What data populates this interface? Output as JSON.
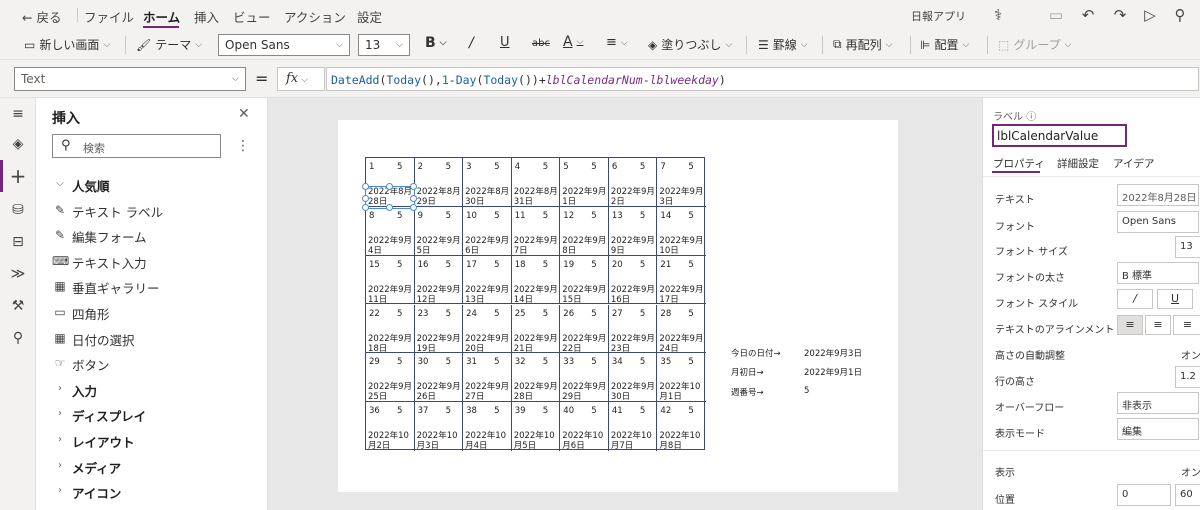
{
  "menu": {
    "back": "戻る",
    "items": [
      "ファイル",
      "ホーム",
      "挿入",
      "ビュー",
      "アクション",
      "設定"
    ],
    "app_name": "日報アプリ"
  },
  "toolbar": {
    "new_screen": "新しい画面",
    "theme": "テーマ",
    "font": "Open Sans",
    "font_size": "13",
    "fill": "塗りつぶし",
    "border": "罫線",
    "reorder": "再配列",
    "align": "配置",
    "group": "グループ"
  },
  "formula_bar": {
    "property": "Text",
    "equals": "=",
    "fx": "fx",
    "formula": [
      {
        "t": "DateAdd",
        "c": "fn"
      },
      {
        "t": "(",
        "c": "op"
      },
      {
        "t": "Today",
        "c": "fn"
      },
      {
        "t": "(),",
        "c": "op"
      },
      {
        "t": "1",
        "c": "num"
      },
      {
        "t": "-",
        "c": "op"
      },
      {
        "t": "Day",
        "c": "fn"
      },
      {
        "t": "(",
        "c": "op"
      },
      {
        "t": "Today",
        "c": "fn"
      },
      {
        "t": "()",
        "c": "op"
      },
      {
        "t": ")+",
        "c": "op"
      },
      {
        "t": "lblCalendarNum",
        "c": "ref"
      },
      {
        "t": "-",
        "c": "op"
      },
      {
        "t": "lblweekday",
        "c": "ref"
      },
      {
        "t": ")",
        "c": "op"
      }
    ]
  },
  "insert_panel": {
    "title": "挿入",
    "search_placeholder": "検索",
    "items": [
      {
        "label": "人気順",
        "type": "category",
        "icon": "chevron-down-icon"
      },
      {
        "label": "テキスト ラベル",
        "type": "item",
        "icon": "text-label-icon"
      },
      {
        "label": "編集フォーム",
        "type": "item",
        "icon": "edit-form-icon"
      },
      {
        "label": "テキスト入力",
        "type": "item",
        "icon": "text-input-icon"
      },
      {
        "label": "垂直ギャラリー",
        "type": "item",
        "icon": "gallery-icon"
      },
      {
        "label": "四角形",
        "type": "item",
        "icon": "rectangle-icon"
      },
      {
        "label": "日付の選択",
        "type": "item",
        "icon": "calendar-icon"
      },
      {
        "label": "ボタン",
        "type": "item",
        "icon": "button-icon"
      },
      {
        "label": "入力",
        "type": "category",
        "icon": "chevron-right-icon"
      },
      {
        "label": "ディスプレイ",
        "type": "category",
        "icon": "chevron-right-icon"
      },
      {
        "label": "レイアウト",
        "type": "category",
        "icon": "chevron-right-icon"
      },
      {
        "label": "メディア",
        "type": "category",
        "icon": "chevron-right-icon"
      },
      {
        "label": "アイコン",
        "type": "category",
        "icon": "chevron-right-icon"
      }
    ]
  },
  "calendar": {
    "weekday_value": "5",
    "cells": [
      {
        "n": "1",
        "d": "2022年8月28日"
      },
      {
        "n": "2",
        "d": "2022年8月29日"
      },
      {
        "n": "3",
        "d": "2022年8月30日"
      },
      {
        "n": "4",
        "d": "2022年8月31日"
      },
      {
        "n": "5",
        "d": "2022年9月1日"
      },
      {
        "n": "6",
        "d": "2022年9月2日"
      },
      {
        "n": "7",
        "d": "2022年9月3日"
      },
      {
        "n": "8",
        "d": "2022年9月4日"
      },
      {
        "n": "9",
        "d": "2022年9月5日"
      },
      {
        "n": "10",
        "d": "2022年9月6日"
      },
      {
        "n": "11",
        "d": "2022年9月7日"
      },
      {
        "n": "12",
        "d": "2022年9月8日"
      },
      {
        "n": "13",
        "d": "2022年9月9日"
      },
      {
        "n": "14",
        "d": "2022年9月10日"
      },
      {
        "n": "15",
        "d": "2022年9月11日"
      },
      {
        "n": "16",
        "d": "2022年9月12日"
      },
      {
        "n": "17",
        "d": "2022年9月13日"
      },
      {
        "n": "18",
        "d": "2022年9月14日"
      },
      {
        "n": "19",
        "d": "2022年9月15日"
      },
      {
        "n": "20",
        "d": "2022年9月16日"
      },
      {
        "n": "21",
        "d": "2022年9月17日"
      },
      {
        "n": "22",
        "d": "2022年9月18日"
      },
      {
        "n": "23",
        "d": "2022年9月19日"
      },
      {
        "n": "24",
        "d": "2022年9月20日"
      },
      {
        "n": "25",
        "d": "2022年9月21日"
      },
      {
        "n": "26",
        "d": "2022年9月22日"
      },
      {
        "n": "27",
        "d": "2022年9月23日"
      },
      {
        "n": "28",
        "d": "2022年9月24日"
      },
      {
        "n": "29",
        "d": "2022年9月25日"
      },
      {
        "n": "30",
        "d": "2022年9月26日"
      },
      {
        "n": "31",
        "d": "2022年9月27日"
      },
      {
        "n": "32",
        "d": "2022年9月28日"
      },
      {
        "n": "33",
        "d": "2022年9月29日"
      },
      {
        "n": "34",
        "d": "2022年9月30日"
      },
      {
        "n": "35",
        "d": "2022年10月1日"
      },
      {
        "n": "36",
        "d": "2022年10月2日"
      },
      {
        "n": "37",
        "d": "2022年10月3日"
      },
      {
        "n": "38",
        "d": "2022年10月4日"
      },
      {
        "n": "39",
        "d": "2022年10月5日"
      },
      {
        "n": "40",
        "d": "2022年10月6日"
      },
      {
        "n": "41",
        "d": "2022年10月7日"
      },
      {
        "n": "42",
        "d": "2022年10月8日"
      }
    ]
  },
  "info": {
    "today_label": "今日の日付→",
    "today_value": "2022年9月3日",
    "first_label": "月初日→",
    "first_value": "2022年9月1日",
    "weekday_label": "週番号→",
    "weekday_value": "5"
  },
  "properties": {
    "section_label": "ラベル",
    "control_name": "lblCalendarValue",
    "tabs": [
      "プロパティ",
      "詳細設定",
      "アイデア"
    ],
    "text_label": "テキスト",
    "text_value": "2022年8月28日",
    "font_label": "フォント",
    "font_value": "Open Sans",
    "font_size_label": "フォント サイズ",
    "font_size_value": "13",
    "font_weight_label": "フォントの太さ",
    "font_weight_value": "B 標準",
    "font_style_label": "フォント スタイル",
    "text_align_label": "テキストのアラインメント",
    "auto_height_label": "高さの自動調整",
    "auto_height_value": "オン",
    "line_height_label": "行の高さ",
    "line_height_value": "1.2",
    "overflow_label": "オーバーフロー",
    "overflow_value": "非表示",
    "display_mode_label": "表示モード",
    "display_mode_value": "編集",
    "visible_label": "表示",
    "visible_value": "オン",
    "position_label": "位置",
    "position_x": "0",
    "position_y": "60"
  }
}
